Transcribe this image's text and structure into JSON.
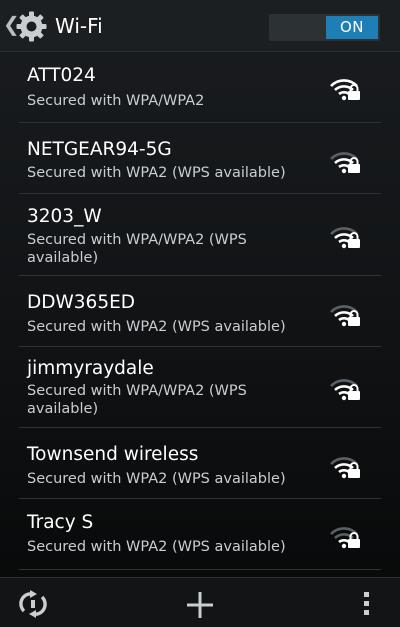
{
  "header": {
    "title": "Wi-Fi",
    "toggle_label": "ON",
    "settings_icon": "gear-icon",
    "accent_color": "#1d7fb6"
  },
  "networks": [
    {
      "ssid": "ATT024",
      "status": "Secured with WPA/WPA2",
      "icon": "wifi-signal-locked-icon",
      "signal_bars": 4
    },
    {
      "ssid": "NETGEAR94-5G",
      "status": "Secured with WPA2 (WPS available)",
      "icon": "wifi-signal-locked-icon",
      "signal_bars": 3
    },
    {
      "ssid": "3203_W",
      "status": "Secured with WPA/WPA2 (WPS available)",
      "icon": "wifi-signal-locked-icon",
      "signal_bars": 3
    },
    {
      "ssid": "DDW365ED",
      "status": "Secured with WPA2 (WPS available)",
      "icon": "wifi-signal-locked-icon",
      "signal_bars": 3
    },
    {
      "ssid": "jimmyraydale",
      "status": "Secured with WPA/WPA2 (WPS available)",
      "icon": "wifi-signal-locked-icon",
      "signal_bars": 3
    },
    {
      "ssid": "Townsend wireless",
      "status": "Secured with WPA2 (WPS available)",
      "icon": "wifi-signal-locked-icon",
      "signal_bars": 3
    },
    {
      "ssid": "Tracy S",
      "status": "Secured with WPA2 (WPS available)",
      "icon": "wifi-signal-locked-icon",
      "signal_bars": 2
    }
  ],
  "bottom_bar": {
    "buttons": [
      {
        "icon": "wps-push-icon"
      },
      {
        "icon": "add-icon"
      },
      {
        "icon": "overflow-menu-icon"
      }
    ]
  }
}
